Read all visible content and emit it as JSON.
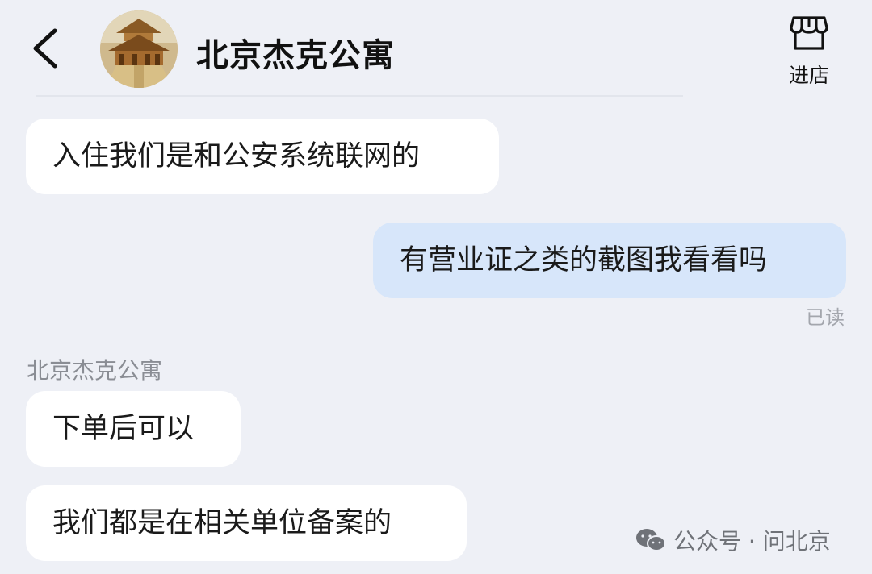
{
  "header": {
    "title": "北京杰克公寓",
    "store_label": "进店"
  },
  "messages": [
    {
      "side": "incoming",
      "text": "入住我们是和公安系统联网的"
    },
    {
      "side": "outgoing",
      "text": "有营业证之类的截图我看看吗",
      "status": "已读"
    },
    {
      "side": "incoming",
      "sender": "北京杰克公寓",
      "text": "下单后可以"
    },
    {
      "side": "incoming",
      "text": "我们都是在相关单位备案的"
    }
  ],
  "watermark": {
    "text": "公众号 · 问北京",
    "icon": "wechat-icon"
  },
  "icons": {
    "back": "chevron-left-icon",
    "avatar": "palace-avatar",
    "store": "storefront-icon"
  },
  "colors": {
    "background": "#eef0f6",
    "incoming_bubble": "#ffffff",
    "outgoing_bubble": "#d7e6fa",
    "read_status": "#a3a6ad"
  }
}
